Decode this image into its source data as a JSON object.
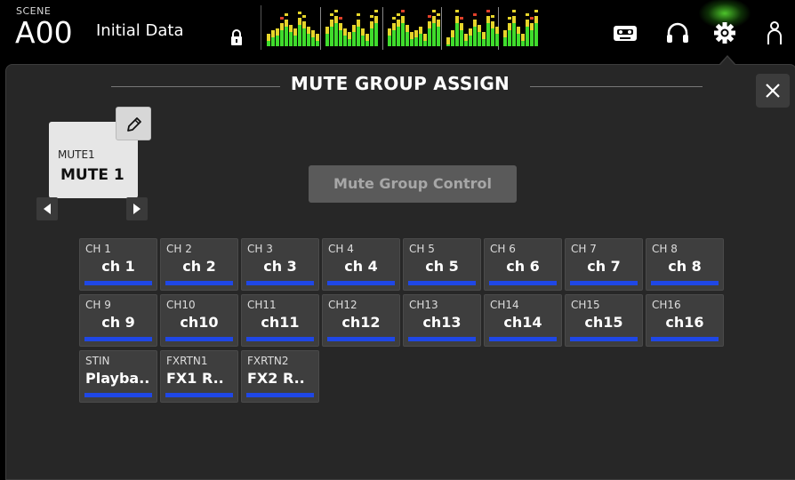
{
  "scene": {
    "label": "SCENE",
    "number": "A00",
    "name": "Initial Data"
  },
  "header_icons": [
    "lock-icon",
    "recorder-icon",
    "headphones-icon",
    "settings-gear-icon",
    "user-icon"
  ],
  "panel": {
    "title": "MUTE GROUP ASSIGN",
    "close_icon": "close-icon"
  },
  "mute_group": {
    "small_label": "MUTE1",
    "name": "MUTE 1",
    "edit_icon": "pencil-icon",
    "prev_icon": "arrow-left-icon",
    "next_icon": "arrow-right-icon"
  },
  "mute_group_control": {
    "label": "Mute Group Control"
  },
  "channels": [
    {
      "num": "CH 1",
      "name": "ch 1"
    },
    {
      "num": "CH 2",
      "name": "ch 2"
    },
    {
      "num": "CH 3",
      "name": "ch 3"
    },
    {
      "num": "CH 4",
      "name": "ch 4"
    },
    {
      "num": "CH 5",
      "name": "ch 5"
    },
    {
      "num": "CH 6",
      "name": "ch 6"
    },
    {
      "num": "CH 7",
      "name": "ch 7"
    },
    {
      "num": "CH 8",
      "name": "ch 8"
    },
    {
      "num": "CH 9",
      "name": "ch 9"
    },
    {
      "num": "CH10",
      "name": "ch10"
    },
    {
      "num": "CH11",
      "name": "ch11"
    },
    {
      "num": "CH12",
      "name": "ch12"
    },
    {
      "num": "CH13",
      "name": "ch13"
    },
    {
      "num": "CH14",
      "name": "ch14"
    },
    {
      "num": "CH15",
      "name": "ch15"
    },
    {
      "num": "CH16",
      "name": "ch16"
    },
    {
      "num": "STIN",
      "name": "Playba.."
    },
    {
      "num": "FXRTN1",
      "name": "FX1 R.."
    },
    {
      "num": "FXRTN2",
      "name": "FX2 R.."
    }
  ],
  "colors": {
    "assign_bar": "#1f47e6",
    "meter_green": "#3fdc2c",
    "meter_yellow": "#e6d52a",
    "meter_red": "#e0402a",
    "active_glow": "#5ae632"
  }
}
